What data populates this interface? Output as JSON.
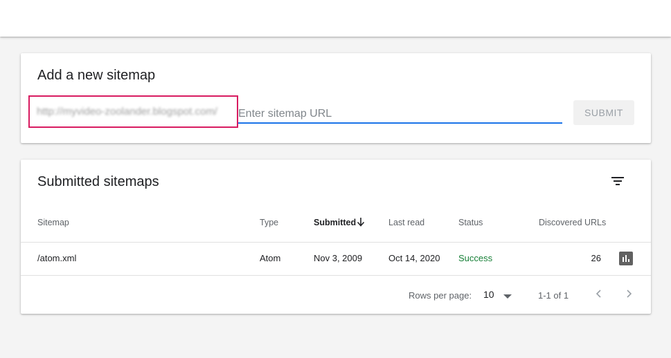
{
  "add_sitemap": {
    "title": "Add a new sitemap",
    "prefix": "http://myvideo-zoolander.blogspot.com/",
    "placeholder": "Enter sitemap URL",
    "value": "",
    "submit_label": "SUBMIT"
  },
  "submitted": {
    "title": "Submitted sitemaps",
    "filter_icon": "filter-icon",
    "columns": [
      "Sitemap",
      "Type",
      "Submitted",
      "Last read",
      "Status",
      "Discovered URLs"
    ],
    "sorted_column": "Submitted",
    "sort_direction": "descending",
    "rows": [
      {
        "sitemap": "/atom.xml",
        "type": "Atom",
        "submitted": "Nov 3, 2009",
        "last_read": "Oct 14, 2020",
        "status": "Success",
        "discovered_urls": "26",
        "action_icon": "bar-chart-icon"
      }
    ],
    "pagination": {
      "rows_per_page_label": "Rows per page:",
      "rows_per_page": "10",
      "range": "1-1 of 1"
    }
  },
  "colors": {
    "accent": "#1a73e8",
    "success": "#188038",
    "highlight_box": "#d81b60"
  }
}
